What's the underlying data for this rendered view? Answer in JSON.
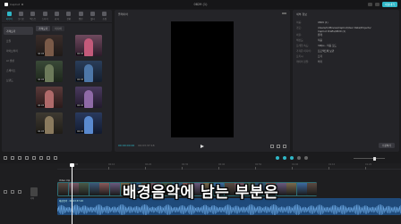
{
  "window": {
    "title": "0829 (1)",
    "app_name": "CapCut",
    "export_label": "내보내기"
  },
  "toolbar": {
    "items": [
      {
        "label": "미디어",
        "active": true
      },
      {
        "label": "오디오",
        "active": false
      },
      {
        "label": "텍스트",
        "active": false
      },
      {
        "label": "스티커",
        "active": false
      },
      {
        "label": "효과",
        "active": false
      },
      {
        "label": "전환",
        "active": false
      },
      {
        "label": "캡션",
        "active": false
      },
      {
        "label": "필터",
        "active": false
      },
      {
        "label": "조정",
        "active": false
      }
    ]
  },
  "sidebar": {
    "items": [
      {
        "label": "가져오기",
        "active": true
      },
      {
        "label": "로컬",
        "active": false
      },
      {
        "label": "라이브러리",
        "active": false
      },
      {
        "label": "AI 생성",
        "active": false
      },
      {
        "label": "스페이스",
        "active": false
      },
      {
        "label": "브랜드",
        "active": false
      }
    ]
  },
  "media": {
    "tabs": [
      "가져오기",
      "미디어"
    ],
    "thumbnails": [
      {
        "badge": "00:05"
      },
      {
        "badge": "00:05"
      },
      {
        "badge": "00:05"
      },
      {
        "badge": "00:05"
      },
      {
        "badge": "00:05"
      },
      {
        "badge": "00:05"
      },
      {
        "badge": "00:05"
      },
      {
        "badge": "00:05"
      }
    ]
  },
  "player": {
    "header": "플레이어",
    "time_current": "00:00:00:00",
    "time_total": "00:03:37:18"
  },
  "details": {
    "header": "세부 정보",
    "rows": [
      {
        "key": "이름:",
        "value": "0829 (1)"
      },
      {
        "key": "경로:",
        "value": "/Users/hi/Movies/CapCut/User Data/Projects/\nCapCut Drafts/0829 (1)"
      },
      {
        "key": "비율:",
        "value": "원래"
      },
      {
        "key": "해상도:",
        "value": "적응"
      },
      {
        "key": "프레임 속도:",
        "value": "30fps - 적응 모드"
      },
      {
        "key": "가져온 미디어:",
        "value": "프로젝트에 보관"
      },
      {
        "key": "프록시:",
        "value": "끄기"
      },
      {
        "key": "레이어 정렬:",
        "value": "켜기"
      }
    ],
    "modify_label": "수정하기"
  },
  "timeline": {
    "ruler_ticks": [
      "00:00",
      "00:10",
      "00:20",
      "00:30",
      "00:40",
      "00:50",
      "01:00",
      "01:10",
      "01:20"
    ],
    "cover_label": "커버",
    "clip_label": "Video clip",
    "audio_label": "배경음악 · 00:03:37:18"
  },
  "subtitle": {
    "text": "배경음악에 남는 부분은"
  },
  "colors": {
    "accent": "#2fb7c7",
    "video_track": "#2f6d73",
    "audio_track": "#1f4a7a"
  }
}
